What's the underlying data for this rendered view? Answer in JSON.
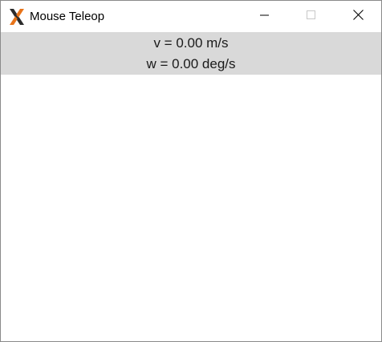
{
  "window": {
    "title": "Mouse Teleop",
    "app_icon": "x11-icon",
    "controls": [
      "minimize-icon",
      "maximize-icon",
      "close-icon"
    ]
  },
  "readout": {
    "linear_velocity": "v = 0.00 m/s",
    "angular_velocity": "w = 0.00 deg/s"
  },
  "colors": {
    "readout_background": "#d9d9d9",
    "canvas_background": "#ffffff",
    "app_icon_orange": "#e8741a",
    "app_icon_dark": "#2b2b2b"
  }
}
